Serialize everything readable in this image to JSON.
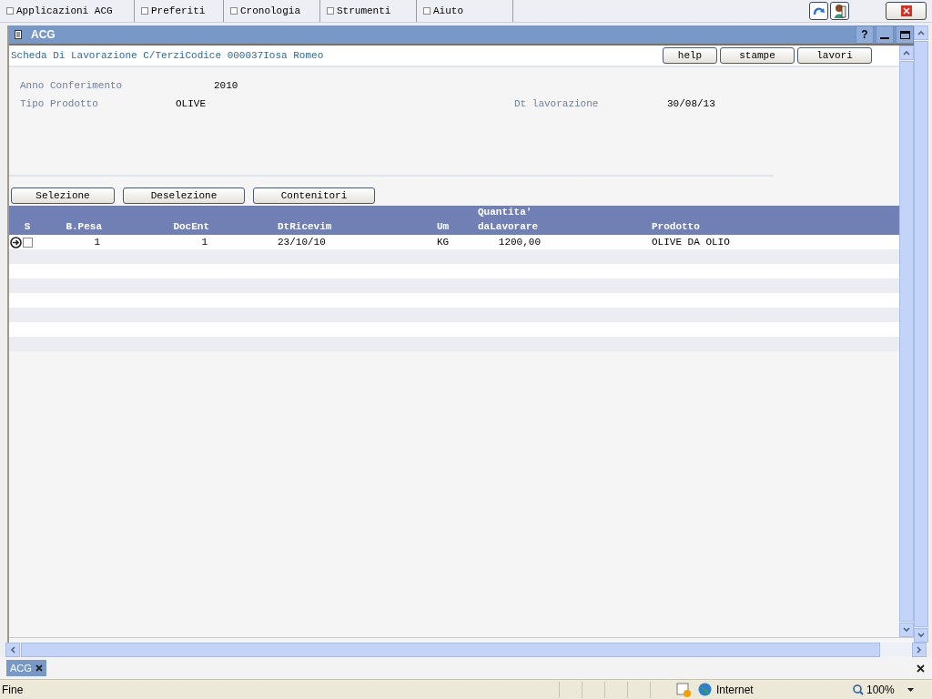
{
  "menu": [
    {
      "label": "Applicazioni ACG"
    },
    {
      "label": "Preferiti"
    },
    {
      "label": "Cronologia"
    },
    {
      "label": "Strumenti"
    },
    {
      "label": "Aiuto"
    }
  ],
  "window": {
    "title": "ACG",
    "help": "?"
  },
  "header": {
    "title": "Scheda Di Lavorazione C/TerziCodice 000037Iosa Romeo",
    "buttons": [
      "help",
      "stampe",
      "lavori"
    ]
  },
  "form": [
    [
      {
        "label": "Anno Conferimento",
        "value": "2010"
      }
    ],
    [
      {
        "label": "Tipo Prodotto",
        "value": "OLIVE"
      },
      {
        "label": "Dt lavorazione",
        "value": "30/08/13"
      }
    ]
  ],
  "actions": [
    "Selezione",
    "Deselezione",
    "Contenitori"
  ],
  "table": {
    "columns": [
      "S",
      "B.Pesa",
      "DocEnt",
      "DtRicevim",
      "Um",
      "Quantita' daLavorare",
      "Prodotto"
    ],
    "rows": [
      {
        "current": true,
        "checked": false,
        "cells": [
          "",
          "1",
          "1",
          "23/10/10",
          "KG",
          "1200,00",
          "OLIVE DA OLIO"
        ]
      }
    ]
  },
  "tabs": [
    {
      "label": "ACG",
      "selected": true
    }
  ],
  "status": {
    "text": "Fine",
    "zone": "Internet",
    "zoom": "100%"
  }
}
